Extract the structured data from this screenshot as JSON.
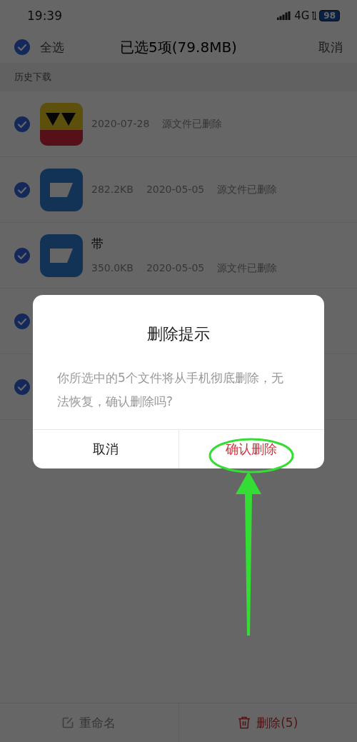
{
  "status_bar": {
    "time": "19:39",
    "network": "4G",
    "battery": "98"
  },
  "header": {
    "select_all": {
      "label": "全选",
      "checked": true
    },
    "title": "已选5项(79.8MB)",
    "cancel": "取消"
  },
  "section": "历史下载",
  "files": [
    {
      "kind": "image",
      "checked": true,
      "date": "2020-07-28",
      "status": "源文件已删除"
    },
    {
      "kind": "doc",
      "checked": true,
      "size": "282.2KB",
      "date": "2020-05-05",
      "status": "源文件已删除"
    },
    {
      "kind": "doc",
      "checked": true,
      "name": "带",
      "size": "350.0KB",
      "date": "2020-05-05",
      "status": "源文件已删除"
    },
    {
      "checked": true
    },
    {
      "checked": true
    }
  ],
  "bottom_bar": [
    {
      "kind": "rename",
      "label": "重命名"
    },
    {
      "kind": "delete",
      "label": "删除(5)"
    }
  ],
  "dialog": {
    "title": "删除提示",
    "message": "你所选中的5个文件将从手机彻底删除，无法恢复，确认删除吗?",
    "buttons": [
      {
        "kind": "cancel",
        "label": "取消"
      },
      {
        "kind": "confirm",
        "label": "确认删除"
      }
    ]
  }
}
